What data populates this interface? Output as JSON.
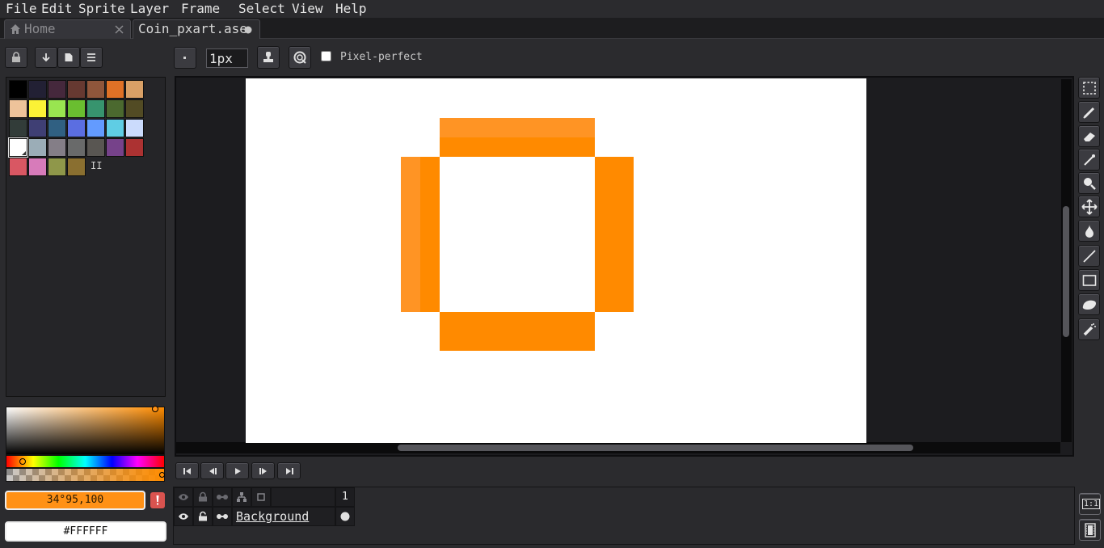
{
  "menu": [
    "File",
    "Edit",
    "Sprite",
    "Layer",
    "Frame",
    "Select",
    "View",
    "Help"
  ],
  "tabs": {
    "home": "Home",
    "file": "Coin_pxart.ase"
  },
  "toolbar": {
    "brush_size": "1px",
    "pixel_perfect_label": "Pixel-perfect",
    "pixel_perfect_checked": false
  },
  "palette": {
    "colors": [
      "#000000",
      "#222034",
      "#45283c",
      "#663931",
      "#8f563b",
      "#df7126",
      "#d9a066",
      "#eec39a",
      "#fbf236",
      "#99e550",
      "#6abe30",
      "#37946e",
      "#4b692f",
      "#524b24",
      "#323c39",
      "#3f3f74",
      "#306082",
      "#5b6ee1",
      "#639bff",
      "#5fcde4",
      "#cbdbfc",
      "#ffffff",
      "#9badb7",
      "#847e87",
      "#696a6a",
      "#595652",
      "#76428a",
      "#ac3232",
      "#d95763",
      "#d77bba",
      "#8f974a",
      "#8a6f30"
    ],
    "selected_index": 21
  },
  "color_picker": {
    "fg_color": "#ff9116",
    "fg_label": "34°95,100",
    "bg_color": "#ffffff",
    "bg_label": "#FFFFFF"
  },
  "accent": "#ff8c00",
  "timeline": {
    "layer_name": "Background",
    "frame_number": "1"
  },
  "status": {
    "zoom_button": "1:1"
  },
  "icons": {
    "home": "home-icon",
    "close": "close-icon",
    "lock": "lock-icon",
    "arrow_down": "arrow-down-icon",
    "page": "page-icon",
    "menu": "hamburger-menu-icon",
    "dot": "brush-shape-icon",
    "stamp": "ink-stamp-icon",
    "spray": "spray-dynamics-icon",
    "tools": [
      "marquee-select-icon",
      "pencil-icon",
      "eraser-icon",
      "eyedropper-icon",
      "zoom-icon",
      "move-icon",
      "paint-bucket-icon",
      "line-icon",
      "rectangle-icon",
      "blur-icon",
      "spray-icon"
    ],
    "playback": [
      "first-frame-icon",
      "prev-frame-icon",
      "play-icon",
      "next-frame-icon",
      "last-frame-icon"
    ]
  }
}
